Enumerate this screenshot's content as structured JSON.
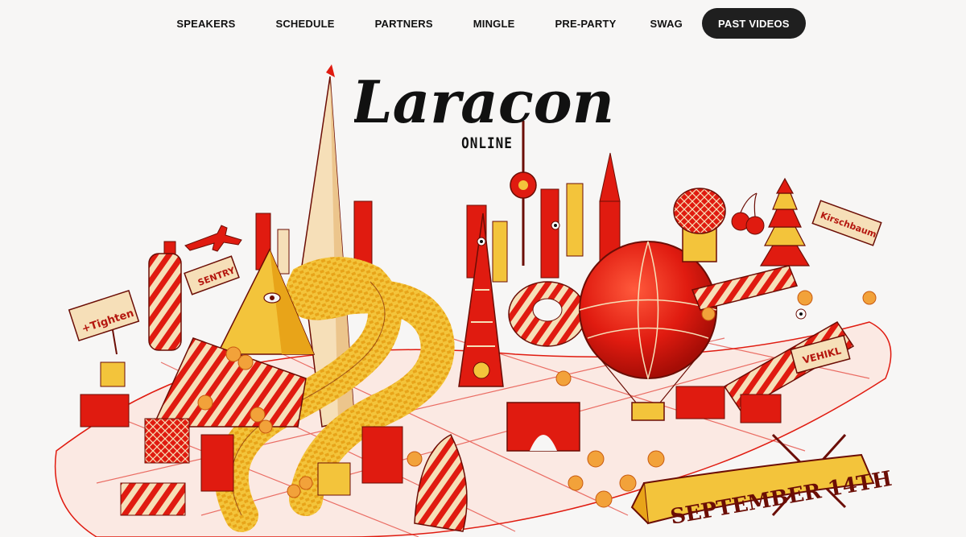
{
  "nav": {
    "items": [
      {
        "label": "SPEAKERS"
      },
      {
        "label": "SCHEDULE"
      },
      {
        "label": "PARTNERS"
      },
      {
        "label": "MINGLE"
      },
      {
        "label": "PRE-PARTY"
      },
      {
        "label": "SWAG"
      },
      {
        "label": "PAST VIDEOS",
        "active": true
      }
    ]
  },
  "hero": {
    "logo_text": "Laracon",
    "logo_subtitle": "ONLINE",
    "date_banner": "SEPTEMBER 14TH",
    "signs": {
      "tighten": "+Tighten",
      "sentry": "SENTRY",
      "kirschbaum": "Kirschbaum",
      "vehikl": "VEHIKL"
    }
  },
  "colors": {
    "background": "#f7f6f5",
    "accent_red": "#e01b10",
    "accent_yellow": "#f3c43b",
    "cream": "#f6dfb8",
    "ink": "#111111",
    "nav_active_bg": "#1f1f1f"
  }
}
